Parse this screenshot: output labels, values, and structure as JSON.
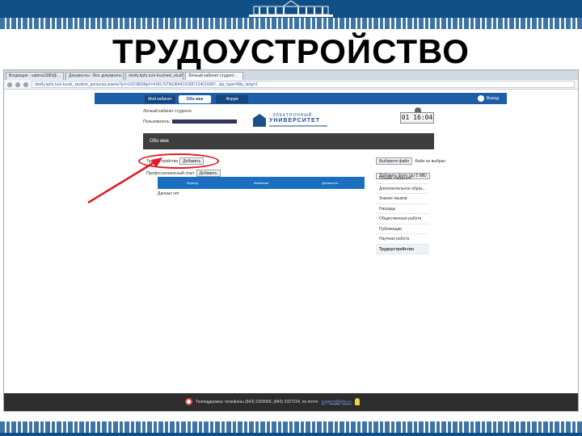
{
  "slide": {
    "title": "ТРУДОУСТРОЙСТВО"
  },
  "browser": {
    "tabs": [
      "Входящие - sabina1980@...",
      "Документы - Все документы",
      "shelly.kpfu.ru/e-ksu/new_stud/...",
      "Личный кабинет студент..."
    ],
    "url": "shelly.kpfu.ru/e-ksu/k_student_personal.anketa?p1=10218568p2=4181707563849191587124615087...&p_type=98p_lang=1"
  },
  "site": {
    "nav": {
      "my_cabinet": "Мой кабинет",
      "about_me": "Обо мне",
      "forum": "Форум",
      "exit": "Выход"
    },
    "cabinet_label": "Личный кабинет студента",
    "user_label": "Пользователь:",
    "logo": {
      "line1": "ЭЛЕКТРОННЫЙ",
      "line2": "УНИВЕРСИТЕТ"
    },
    "clock": "01 16:04",
    "section_title": "Обо мне",
    "employment_label": "Трудоустройство",
    "add_label": "Добавить",
    "prof_label": "Профессиональный опыт",
    "table_headers": [
      "Период",
      "Компания",
      "Должность"
    ],
    "no_data": "Данных нет",
    "choose_file": "Выберите файл",
    "file_not_chosen": "Файл не выбран",
    "add_photo": "Добавить фото (до 5 МБ)",
    "side_menu": [
      "Общие сведения",
      "Дополнительное образ...",
      "Знание языков",
      "Награды",
      "Общественная работа",
      "Публикации",
      "Научная работа",
      "Трудоустройство"
    ],
    "footer_text": "Техподдержка: телефоны (843) 2303066, (843) 2337224, по почте",
    "footer_link": "support@kpfu.ru"
  }
}
